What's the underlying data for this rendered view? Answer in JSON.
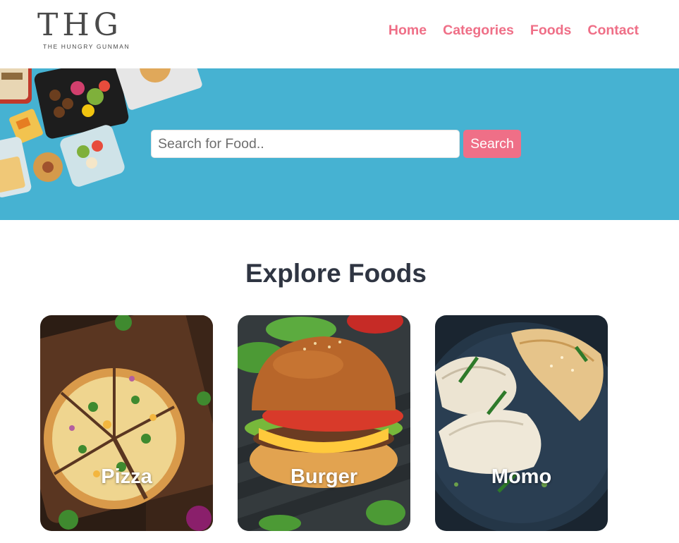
{
  "logo": {
    "mark": "THG",
    "tagline": "THE HUNGRY GUNMAN"
  },
  "nav": {
    "items": [
      {
        "label": "Home"
      },
      {
        "label": "Categories"
      },
      {
        "label": "Foods"
      },
      {
        "label": "Contact"
      }
    ]
  },
  "search": {
    "placeholder": "Search for Food..",
    "value": "",
    "button_label": "Search"
  },
  "explore": {
    "title": "Explore Foods",
    "categories": [
      {
        "label": "Pizza",
        "image": "pizza-photo"
      },
      {
        "label": "Burger",
        "image": "burger-photo"
      },
      {
        "label": "Momo",
        "image": "momo-photo"
      }
    ]
  },
  "colors": {
    "accent": "#ef6f87",
    "banner": "#46b2d2",
    "heading": "#2f3542",
    "logo": "#4a4a4a"
  }
}
